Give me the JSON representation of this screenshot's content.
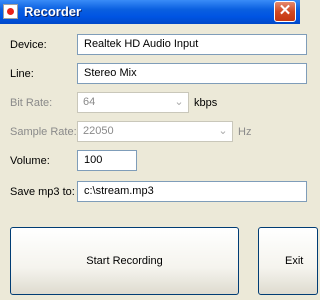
{
  "window": {
    "title": "Recorder",
    "close_glyph": "✕",
    "app_icon": "record-dot-icon"
  },
  "form": {
    "device": {
      "label": "Device:",
      "value": "Realtek HD Audio Input"
    },
    "line": {
      "label": "Line:",
      "value": "Stereo Mix"
    },
    "bitrate": {
      "label": "Bit Rate:",
      "value": "64",
      "unit": "kbps"
    },
    "samplerate": {
      "label": "Sample Rate:",
      "value": "22050",
      "unit": "Hz"
    },
    "volume": {
      "label": "Volume:",
      "value": "100"
    },
    "save": {
      "label": "Save mp3 to:",
      "value": "c:\\stream.mp3"
    }
  },
  "buttons": {
    "start": "Start Recording",
    "exit": "Exit"
  },
  "colors": {
    "titlebar": "#0054e3",
    "window_bg": "#ece9d8",
    "record_red": "#e8211a"
  }
}
